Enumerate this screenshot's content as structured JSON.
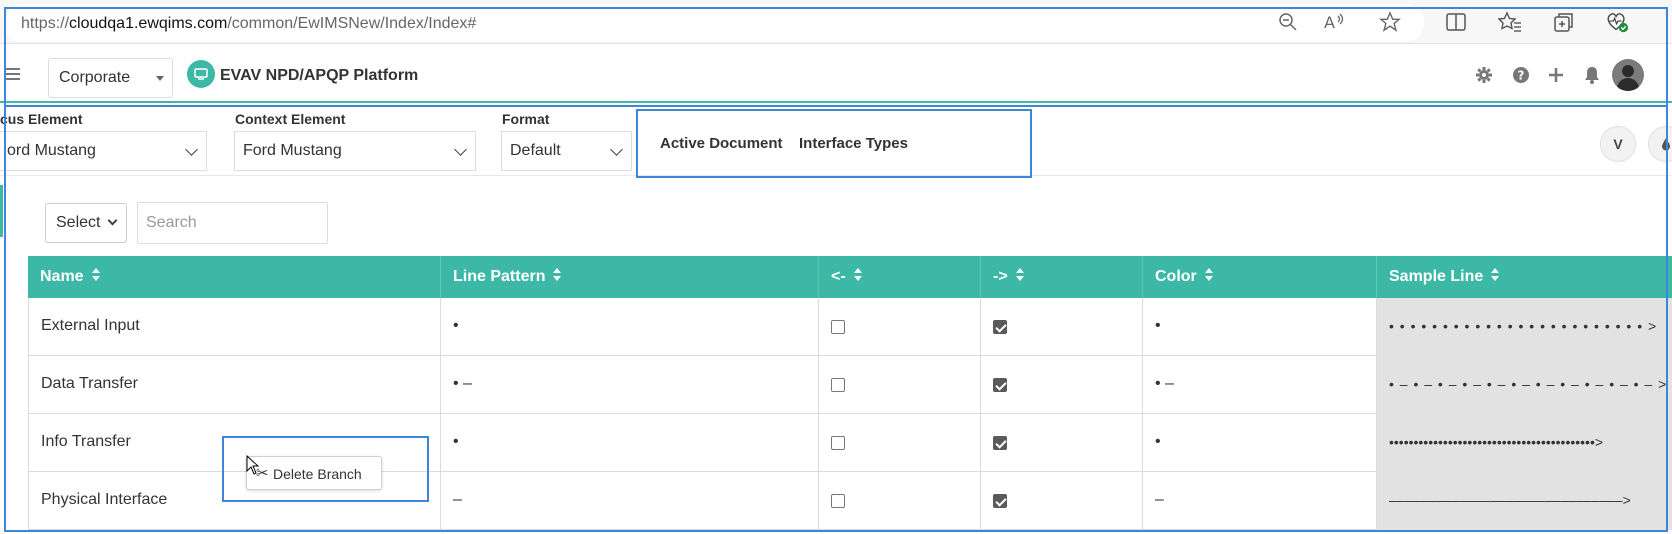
{
  "browser": {
    "url_prefix": "https://",
    "url_domain": "cloudqa1.ewqims.com",
    "url_path": "/common/EwIMSNew/Index/Index#",
    "icons": [
      "zoom-out-icon",
      "read-aloud-icon",
      "favorite-star-icon",
      "split-screen-icon",
      "favorites-icon",
      "collections-icon",
      "browser-essentials-icon"
    ]
  },
  "header": {
    "org_select": "Corporate",
    "platform_title": "EVAV NPD/APQP Platform",
    "icons": [
      "gear-icon",
      "help-icon",
      "plus-icon",
      "bell-icon",
      "avatar-icon"
    ]
  },
  "context_bar": {
    "focus_label": "cus Element",
    "focus_value": "ord Mustang",
    "context_label": "Context Element",
    "context_value": "Ford Mustang",
    "format_label": "Format",
    "format_value": "Default",
    "tabs": [
      "Active Document",
      "Interface Types"
    ],
    "round_button_label": "V"
  },
  "toolbar": {
    "select_label": "Select",
    "search_placeholder": "Search"
  },
  "table": {
    "columns": [
      "Name",
      "Line Pattern",
      "<-",
      "->",
      "Color",
      "Sample Line"
    ],
    "rows": [
      {
        "name": "External Input",
        "pattern": "•",
        "left": false,
        "right": true,
        "color": "•",
        "sample": "• • • • • • • • • • • • • • • • • • • • • • • • >"
      },
      {
        "name": "Data Transfer",
        "pattern": "• –",
        "left": false,
        "right": true,
        "color": "• –",
        "sample": "• – • – • – • – • – • – • – • – • – • – • – >"
      },
      {
        "name": "Info Transfer",
        "pattern": "•",
        "left": false,
        "right": true,
        "color": "•",
        "sample": "••••••••••••••••••••••••••••••••••••••••••>"
      },
      {
        "name": "Physical Interface",
        "pattern": "–",
        "left": false,
        "right": true,
        "color": "–",
        "sample": "––––––––––––––––––––––––––––––>"
      }
    ]
  },
  "context_menu": {
    "item_label": "Delete Branch"
  },
  "colors": {
    "accent": "#3db8a6",
    "highlight": "#3d86d8"
  }
}
